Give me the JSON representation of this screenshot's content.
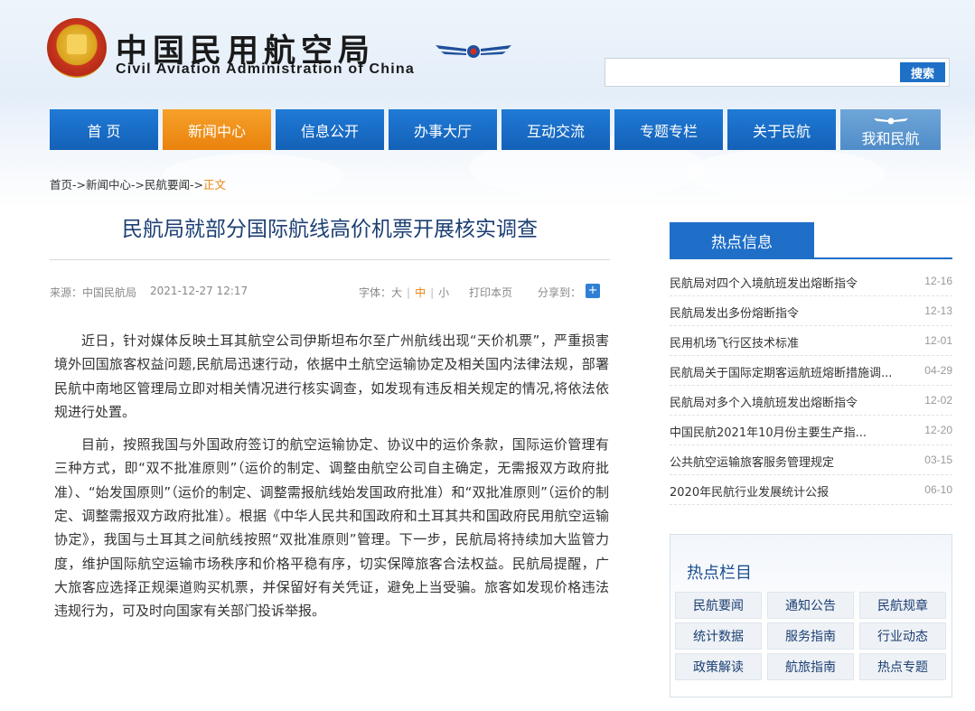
{
  "header": {
    "title_cn": "中国民用航空局",
    "title_en": "Civil Aviation Administration of China",
    "search_placeholder": "",
    "search_button": "搜索"
  },
  "nav": {
    "items": [
      {
        "label": "首 页",
        "active": false
      },
      {
        "label": "新闻中心",
        "active": true
      },
      {
        "label": "信息公开",
        "active": false
      },
      {
        "label": "办事大厅",
        "active": false
      },
      {
        "label": "互动交流",
        "active": false
      },
      {
        "label": "专题专栏",
        "active": false
      },
      {
        "label": "关于民航",
        "active": false
      },
      {
        "label": "我和民航",
        "active": false
      }
    ]
  },
  "breadcrumb": {
    "items": [
      "首页",
      "新闻中心",
      "民航要闻"
    ],
    "separator": "->",
    "current": "正文"
  },
  "article": {
    "title": "民航局就部分国际航线高价机票开展核实调查",
    "source": "来源：中国民航局",
    "date": "2021-12-27 12:17",
    "font_label": "字体：",
    "font_sizes": [
      "大",
      "中",
      "小"
    ],
    "font_selected": "中",
    "print": "打印本页",
    "share": "分享到：",
    "paragraphs": [
      "近日，针对媒体反映土耳其航空公司伊斯坦布尔至广州航线出现“天价机票”，严重损害境外回国旅客权益问题,民航局迅速行动，依据中土航空运输协定及相关国内法律法规，部署民航中南地区管理局立即对相关情况进行核实调查，如发现有违反相关规定的情况,将依法依规进行处置。",
      "目前，按照我国与外国政府签订的航空运输协定、协议中的运价条款，国际运价管理有三种方式，即“双不批准原则”（运价的制定、调整由航空公司自主确定，无需报双方政府批准）、“始发国原则”（运价的制定、调整需报航线始发国政府批准）和“双批准原则”（运价的制定、调整需报双方政府批准）。根据《中华人民共和国政府和土耳其共和国政府民用航空运输协定》，我国与土耳其之间航线按照“双批准原则”管理。下一步，民航局将持续加大监管力度，维护国际航空运输市场秩序和价格平稳有序，切实保障旅客合法权益。民航局提醒，广大旅客应选择正规渠道购买机票，并保留好有关凭证，避免上当受骗。旅客如发现价格违法违规行为，可及时向国家有关部门投诉举报。"
    ]
  },
  "hot_info": {
    "tab": "热点信息",
    "items": [
      {
        "title": "民航局对四个入境航班发出熔断指令",
        "date": "12-16"
      },
      {
        "title": "民航局发出多份熔断指令",
        "date": "12-13"
      },
      {
        "title": "民用机场飞行区技术标准",
        "date": "12-01"
      },
      {
        "title": "民航局关于国际定期客运航班熔断措施调...",
        "date": "04-29"
      },
      {
        "title": "民航局对多个入境航班发出熔断指令",
        "date": "12-02"
      },
      {
        "title": "中国民航2021年10月份主要生产指...",
        "date": "12-20"
      },
      {
        "title": "公共航空运输旅客服务管理规定",
        "date": "03-15"
      },
      {
        "title": "2020年民航行业发展统计公报",
        "date": "06-10"
      }
    ]
  },
  "hot_columns": {
    "title": "热点栏目",
    "items": [
      "民航要闻",
      "通知公告",
      "民航规章",
      "统计数据",
      "服务指南",
      "行业动态",
      "政策解读",
      "航旅指南",
      "热点专题"
    ]
  },
  "colors": {
    "nav_blue": "#1461b7",
    "nav_active": "#e9820d",
    "title_blue": "#1c3f73",
    "accent_orange": "#e9820d"
  }
}
